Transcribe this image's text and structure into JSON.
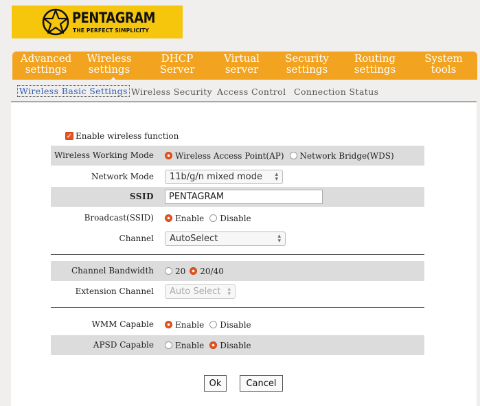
{
  "brand": {
    "name": "PENTAGRAM",
    "tagline": "THE PERFECT SIMPLICITY",
    "color": "#f6c60c"
  },
  "nav": {
    "color": "#f2a31f",
    "items": [
      {
        "label": "Advanced\nsettings"
      },
      {
        "label": "Wireless\nsettings",
        "active": true
      },
      {
        "label": "DHCP\nServer"
      },
      {
        "label": "Virtual\nserver"
      },
      {
        "label": "Security\nsettings"
      },
      {
        "label": "Routing\nsettings"
      },
      {
        "label": "System\ntools"
      }
    ]
  },
  "subtabs": [
    {
      "label": "Wireless Basic Settings",
      "active": true
    },
    {
      "label": "Wireless Security"
    },
    {
      "label": "Access Control"
    },
    {
      "label": "Connection Status"
    }
  ],
  "form": {
    "enable_wireless": {
      "label": "Enable wireless function",
      "checked": true
    },
    "working_mode": {
      "label": "Wireless Working Mode",
      "options": [
        "Wireless Access Point(AP)",
        "Network Bridge(WDS)"
      ],
      "selected": 0
    },
    "network_mode": {
      "label": "Network Mode",
      "value": "11b/g/n mixed mode"
    },
    "ssid": {
      "label": "SSID",
      "value": "PENTAGRAM"
    },
    "broadcast": {
      "label": "Broadcast(SSID)",
      "options": [
        "Enable",
        "Disable"
      ],
      "selected": 0
    },
    "channel": {
      "label": "Channel",
      "value": "AutoSelect"
    },
    "bandwidth": {
      "label": "Channel Bandwidth",
      "options": [
        "20",
        "20/40"
      ],
      "selected": 1
    },
    "extension_channel": {
      "label": "Extension Channel",
      "value": "Auto Select"
    },
    "wmm": {
      "label": "WMM Capable",
      "options": [
        "Enable",
        "Disable"
      ],
      "selected": 0
    },
    "apsd": {
      "label": "APSD Capable",
      "options": [
        "Enable",
        "Disable"
      ],
      "selected": 1
    }
  },
  "buttons": {
    "ok": "Ok",
    "cancel": "Cancel"
  },
  "colors": {
    "accent_radio": "#e8541e",
    "active_tab_text": "#2f5db8"
  }
}
